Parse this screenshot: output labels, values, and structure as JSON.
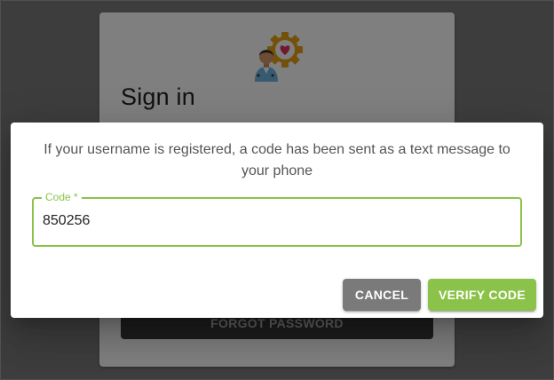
{
  "signin": {
    "title": "Sign in",
    "forgot_password_label": "Forgot password"
  },
  "dialog": {
    "message": "If your username is registered, a code has been sent as a text message to your phone",
    "code_field": {
      "label": "Code *",
      "value": "850256"
    },
    "cancel_label": "Cancel",
    "verify_label": "Verify code"
  },
  "colors": {
    "accent": "#8bc34a",
    "cancel": "#7a7a7a",
    "overlay": "rgba(0,0,0,0.5)"
  },
  "icons": {
    "logo": "doctor-heart-gear-icon"
  }
}
